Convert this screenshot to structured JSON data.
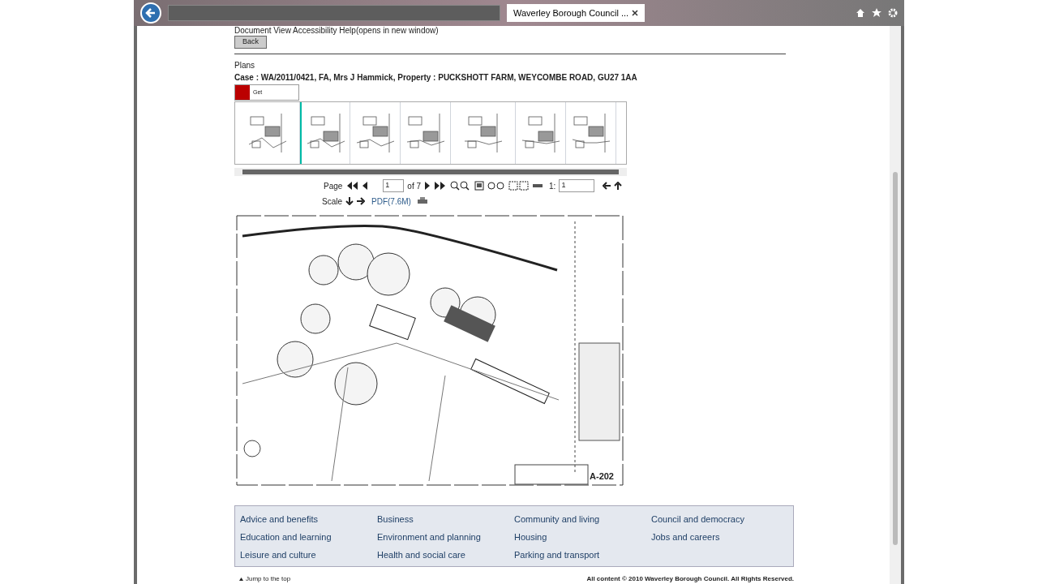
{
  "browser": {
    "tab_title": "Waverley Borough Council ..."
  },
  "page": {
    "help_links": "Document View Accessibility Help(opens in new window)",
    "back_button": "Back",
    "heading": "Plans",
    "case": "Case : WA/2011/0421, FA, Mrs J Hammick, Property : PUCKSHOTT FARM, WEYCOMBE ROAD, GU27 1AA",
    "adobe_badge": "Get",
    "thumbnails": [
      {
        "selected": false
      },
      {
        "selected": true
      },
      {
        "selected": false
      },
      {
        "selected": false
      },
      {
        "selected": false
      },
      {
        "selected": false
      },
      {
        "selected": false
      }
    ],
    "toolbar": {
      "page_label": "Page",
      "page_value": "1",
      "page_total": "of 7",
      "ratio_label": "1:",
      "ratio_value": "1",
      "scale_label": "Scale",
      "pdf_link": "PDF(7.6M)"
    },
    "plan": {
      "sheet_number": "A-202"
    }
  },
  "footer_links": [
    "Advice and benefits",
    "Business",
    "Community and living",
    "Council and democracy",
    "Education and learning",
    "Environment and planning",
    "Housing",
    "Jobs and careers",
    "Leisure and culture",
    "Health and social care",
    "Parking and transport"
  ],
  "footer": {
    "jump": "Jump to the top",
    "copyright": "All content © 2010 Waverley Borough Council. All Rights Reserved."
  }
}
